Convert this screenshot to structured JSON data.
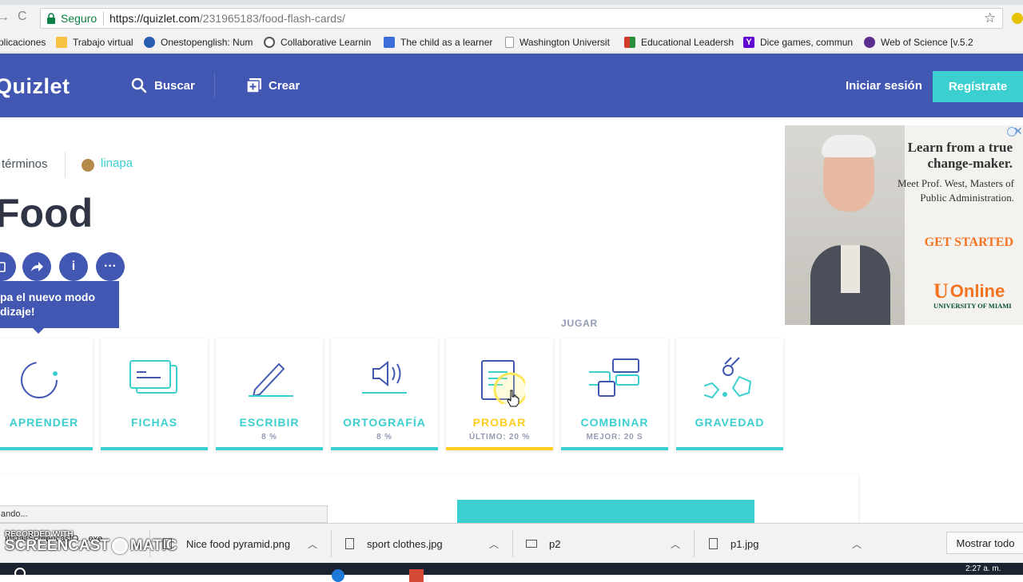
{
  "browser": {
    "secure_label": "Seguro",
    "url_base": "https://quizlet.com",
    "url_path": "/231965183/food-flash-cards/",
    "bookmarks": [
      {
        "label": "plicaciones",
        "icon": "apps-icon",
        "color": "#4a4a4a"
      },
      {
        "label": "Trabajo virtual",
        "icon": "folder-icon",
        "color": "#f5c242"
      },
      {
        "label": "Onestopenglish: Num",
        "icon": "globe-icon",
        "color": "#2a5db0"
      },
      {
        "label": "Collaborative Learnin",
        "icon": "circle-icon",
        "color": "#555555"
      },
      {
        "label": "The child as a learner",
        "icon": "grid-icon",
        "color": "#3b6ed9"
      },
      {
        "label": "Washington Universit",
        "icon": "page-icon",
        "color": "#9a9a9a"
      },
      {
        "label": "Educational Leadersh",
        "icon": "flag-icon",
        "color": "#d23b2b"
      },
      {
        "label": "Dice games, commun",
        "icon": "yahoo-icon",
        "color": "#5f01d1"
      },
      {
        "label": "Web of Science [v.5.2",
        "icon": "wos-icon",
        "color": "#5a2d91"
      }
    ]
  },
  "header": {
    "logo": "Quizlet",
    "search_label": "Buscar",
    "create_label": "Crear",
    "login_label": "Iniciar sesión",
    "signup_label": "Regístrate"
  },
  "set": {
    "terms_label": "términos",
    "author": "linapa",
    "title": "Food",
    "info_glyph": "i",
    "more_glyph": "···",
    "tooltip_line1": "pa el nuevo modo",
    "tooltip_line2": "dizaje!",
    "section_label": "JUGAR"
  },
  "modes": [
    {
      "label": "APRENDER",
      "sub": ""
    },
    {
      "label": "FICHAS",
      "sub": ""
    },
    {
      "label": "ESCRIBIR",
      "sub": "8 %"
    },
    {
      "label": "ORTOGRAFÍA",
      "sub": "8 %"
    },
    {
      "label": "PROBAR",
      "sub": "ÚLTIMO: 20 %"
    },
    {
      "label": "COMBINAR",
      "sub": "MEJOR: 20 S"
    },
    {
      "label": "GRAVEDAD",
      "sub": ""
    }
  ],
  "ad": {
    "headline1": "Learn from a true",
    "headline2": "change-maker.",
    "body1": "Meet Prof. West, Masters of",
    "body2": "Public Administration.",
    "cta": "GET STARTED",
    "brand": "Online",
    "brand_letter": "U",
    "university": "UNIVERSITY OF MIAMI",
    "cta_color": "#f47321",
    "brand_color": "#005030"
  },
  "status_text": "ando...",
  "downloads": {
    "items": [
      "Nice food pyramid.png",
      "sport clothes.jpg",
      "p2",
      "p1.jpg"
    ],
    "partial_item": "InstallScreencastO....exe",
    "show_all": "Mostrar todo",
    "watermark_top": "RECORDED WITH",
    "watermark_brand": "SCREENCAST",
    "watermark_suffix": "MATIC"
  },
  "taskbar": {
    "clock": "2:27 a. m."
  },
  "colors": {
    "brand": "#4257b2",
    "accent": "#3ccfcf",
    "highlight": "#ffcd1f"
  }
}
